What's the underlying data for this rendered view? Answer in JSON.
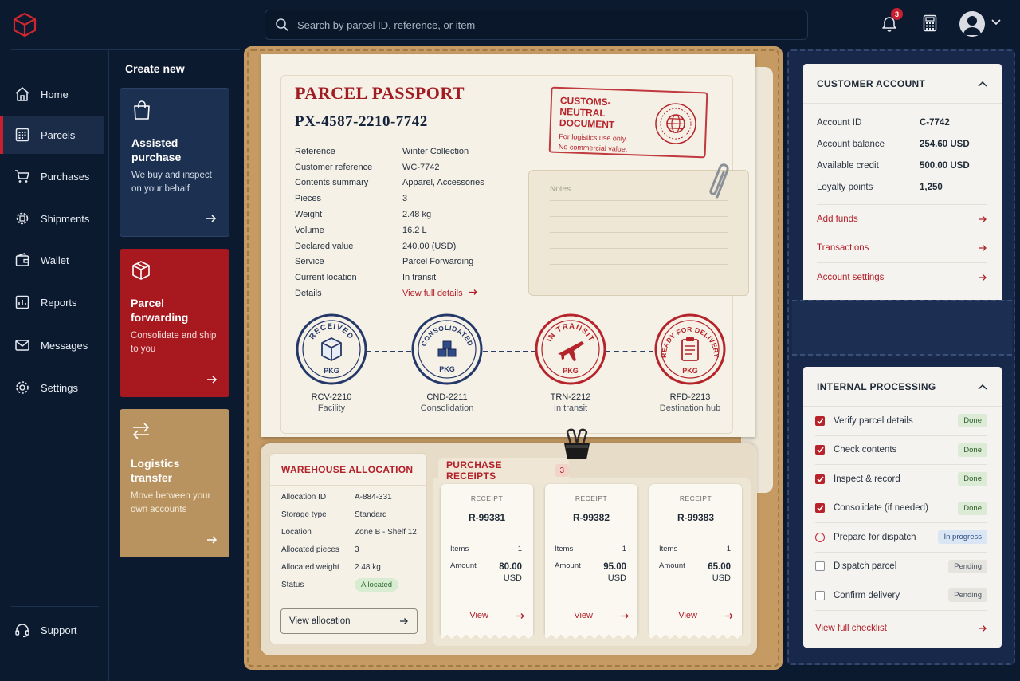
{
  "colors": {
    "brand_red": "#c8202f",
    "navy": "#0c1a30",
    "kraft": "#c59a63"
  },
  "topbar": {
    "search_placeholder": "Search by parcel ID, reference, or item",
    "notification_count": "3"
  },
  "sidebar": {
    "items": [
      {
        "label": "Home",
        "icon": "home-icon"
      },
      {
        "label": "Parcels",
        "icon": "parcels-icon",
        "active": true
      },
      {
        "label": "Purchases",
        "icon": "cart-icon"
      },
      {
        "label": "Shipments",
        "icon": "gear-box-icon"
      },
      {
        "label": "Wallet",
        "icon": "wallet-icon"
      },
      {
        "label": "Reports",
        "icon": "reports-icon"
      },
      {
        "label": "Messages",
        "icon": "mail-icon"
      },
      {
        "label": "Settings",
        "icon": "gear-icon"
      }
    ],
    "support": "Support"
  },
  "create": {
    "title": "Create new",
    "cards": [
      {
        "title": "Assisted purchase",
        "desc": "We buy and inspect on your behalf"
      },
      {
        "title": "Parcel forwarding",
        "desc": "Consolidate and ship to you"
      },
      {
        "title": "Logistics transfer",
        "desc": "Move between your own accounts"
      }
    ]
  },
  "passport": {
    "title": "PARCEL PASSPORT",
    "id": "PX-4587-2210-7742",
    "rows": [
      {
        "k": "Reference",
        "v": "Winter Collection"
      },
      {
        "k": "Customer reference",
        "v": "WC-7742"
      },
      {
        "k": "Contents summary",
        "v": "Apparel, Accessories"
      },
      {
        "k": "Pieces",
        "v": "3"
      },
      {
        "k": "Weight",
        "v": "2.48 kg"
      },
      {
        "k": "Volume",
        "v": "16.2 L"
      },
      {
        "k": "Declared value",
        "v": "240.00 (USD)"
      },
      {
        "k": "Service",
        "v": "Parcel Forwarding"
      },
      {
        "k": "Current location",
        "v": "In transit"
      }
    ],
    "details_label": "Details",
    "details_link": "View full details",
    "customs": {
      "title": "CUSTOMS-NEUTRAL DOCUMENT",
      "line1": "For logistics use only.",
      "line2": "No commercial value."
    },
    "notes_label": "Notes",
    "stamps": [
      {
        "word": "RECEIVED",
        "pkg": "PKG",
        "code": "RCV-2210",
        "label": "Facility"
      },
      {
        "word": "CONSOLIDATED",
        "pkg": "PKG",
        "code": "CND-2211",
        "label": "Consolidation"
      },
      {
        "word": "IN TRANSIT",
        "pkg": "PKG",
        "code": "TRN-2212",
        "label": "In transit"
      },
      {
        "word": "READY FOR DELIVERY",
        "pkg": "PKG",
        "code": "RFD-2213",
        "label": "Destination hub"
      }
    ]
  },
  "warehouse": {
    "title": "WAREHOUSE ALLOCATION",
    "rows": [
      {
        "k": "Allocation ID",
        "v": "A-884-331"
      },
      {
        "k": "Storage type",
        "v": "Standard"
      },
      {
        "k": "Location",
        "v": "Zone B - Shelf 12"
      },
      {
        "k": "Allocated pieces",
        "v": "3"
      },
      {
        "k": "Allocated weight",
        "v": "2.48 kg"
      }
    ],
    "status_label": "Status",
    "status_value": "Allocated",
    "button": "View allocation"
  },
  "receipts": {
    "title": "PURCHASE RECEIPTS",
    "count": "3",
    "items": [
      {
        "label": "RECEIPT",
        "id": "R-99381",
        "items_label": "Items",
        "items": "1",
        "amount_label": "Amount",
        "amount": "80.00",
        "currency": "USD",
        "view": "View"
      },
      {
        "label": "RECEIPT",
        "id": "R-99382",
        "items_label": "Items",
        "items": "1",
        "amount_label": "Amount",
        "amount": "95.00",
        "currency": "USD",
        "view": "View"
      },
      {
        "label": "RECEIPT",
        "id": "R-99383",
        "items_label": "Items",
        "items": "1",
        "amount_label": "Amount",
        "amount": "65.00",
        "currency": "USD",
        "view": "View"
      }
    ]
  },
  "account": {
    "title": "CUSTOMER ACCOUNT",
    "rows": [
      {
        "k": "Account ID",
        "v": "C-7742"
      },
      {
        "k": "Account balance",
        "v": "254.60 USD"
      },
      {
        "k": "Available credit",
        "v": "500.00 USD"
      },
      {
        "k": "Loyalty points",
        "v": "1,250"
      }
    ],
    "links": [
      "Add funds",
      "Transactions",
      "Account settings"
    ]
  },
  "processing": {
    "title": "INTERNAL PROCESSING",
    "steps": [
      {
        "label": "Verify parcel details",
        "status": "Done"
      },
      {
        "label": "Check contents",
        "status": "Done"
      },
      {
        "label": "Inspect & record",
        "status": "Done"
      },
      {
        "label": "Consolidate (if needed)",
        "status": "Done"
      },
      {
        "label": "Prepare for dispatch",
        "status": "In progress"
      },
      {
        "label": "Dispatch parcel",
        "status": "Pending"
      },
      {
        "label": "Confirm delivery",
        "status": "Pending"
      }
    ],
    "link": "View full checklist"
  }
}
